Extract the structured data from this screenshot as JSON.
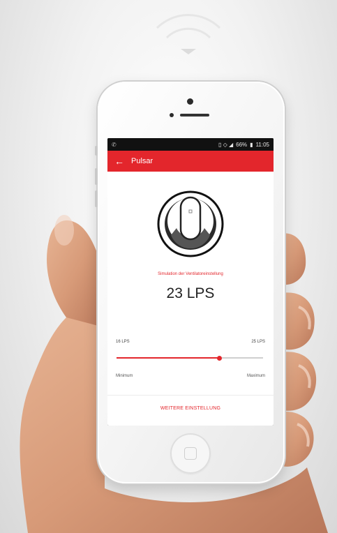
{
  "icons": {
    "wifi": "wifi-icon",
    "back": "arrow-left-icon",
    "device": "pulsar-ventilator-icon"
  },
  "colors": {
    "accent": "#e3262c",
    "statusbar": "#111111",
    "text": "#222222"
  },
  "statusbar": {
    "left": "✆",
    "icons": "▯ ◇ ◢",
    "battery": "66%",
    "time": "11:05"
  },
  "appbar": {
    "back": "←",
    "title": "Pulsar"
  },
  "main": {
    "simulation_label": "Simulation der Ventilatoreinstellung",
    "value": "23 LPS"
  },
  "slider": {
    "min_label": "16 LPS",
    "max_label": "25 LPS",
    "min_caption": "Minimum",
    "max_caption": "Maximum",
    "position": 0.7
  },
  "footer": {
    "more_button": "WEITERE EINSTELLUNG"
  }
}
